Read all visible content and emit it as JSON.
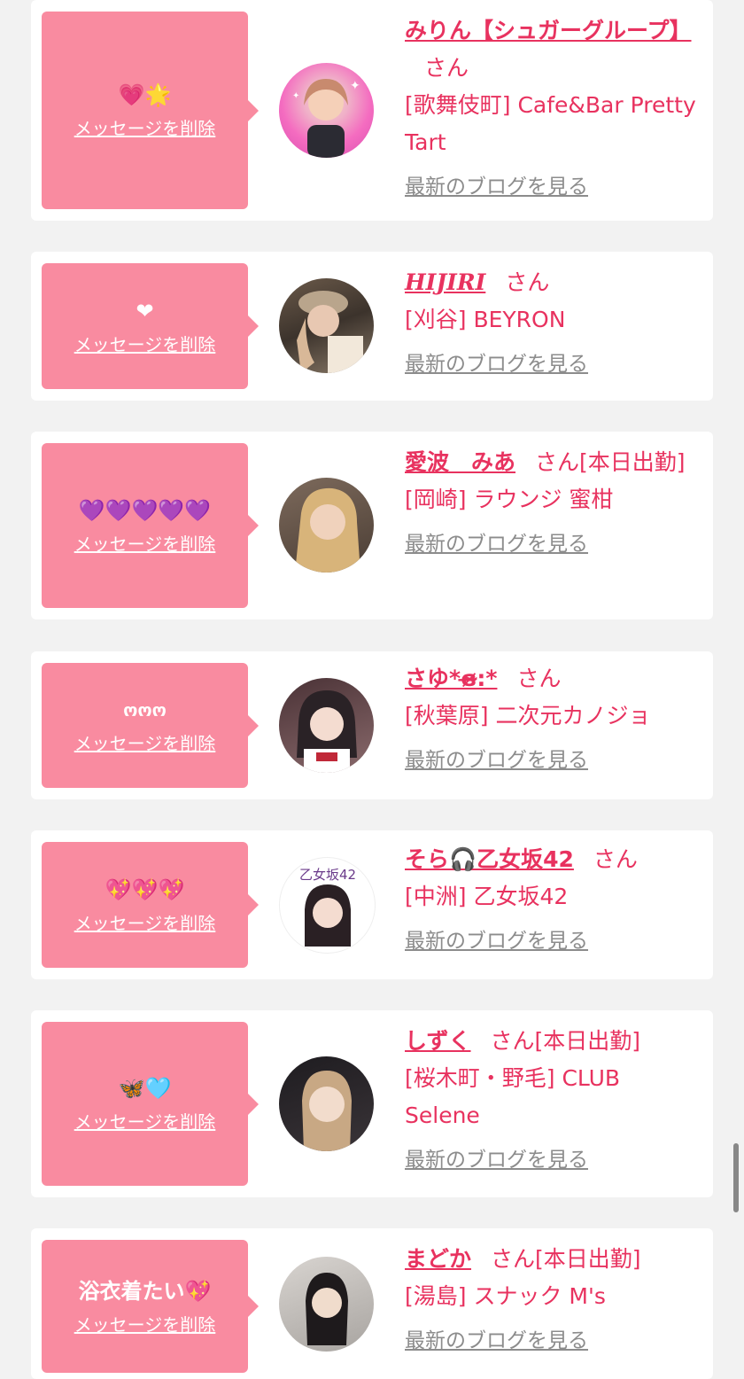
{
  "common": {
    "delete_label": "メッセージを削除",
    "blog_label": "最新のブログを見る",
    "san": "さん"
  },
  "colors": {
    "page_bg": "#f2f2f2",
    "card_bg": "#ffffff",
    "bubble_bg": "#f98ba0",
    "accent": "#e8325f",
    "blog_link": "#8c8c8c"
  },
  "cards": [
    {
      "message": "💗🌟",
      "name": "みりん【シュガーグループ】",
      "suffix": "",
      "shop": "[歌舞伎町] Cafe&Bar Pretty Tart",
      "avatar_desc": "pink-haired-avatar"
    },
    {
      "message": "❤",
      "name": "HIJIRI",
      "suffix": "",
      "shop": "[刈谷] BEYRON",
      "avatar_desc": "avatar-with-cap"
    },
    {
      "message": "💜💜💜💜💜",
      "name": "愛波　みあ",
      "suffix": "[本日出勤]",
      "shop": "[岡崎] ラウンジ 蜜柑",
      "avatar_desc": "avatar-blonde"
    },
    {
      "message": "ოოო",
      "name": "さゆ*ɞ̴̶̷:*",
      "suffix": "",
      "shop": "[秋葉原] 二次元カノジョ",
      "avatar_desc": "avatar-maid"
    },
    {
      "message": "💖💖💖",
      "name": "そら🎧乙女坂42",
      "suffix": "",
      "shop": "[中洲] 乙女坂42",
      "avatar_desc": "avatar-otomezaka",
      "avatar_logo": "乙女坂42"
    },
    {
      "message": "🦋🩵",
      "name": "しずく",
      "suffix": "[本日出勤]",
      "shop": "[桜木町・野毛] CLUB Selene",
      "avatar_desc": "avatar-dark"
    },
    {
      "message": "浴衣着たい💖",
      "name": "まどか",
      "suffix": "[本日出勤]",
      "shop": "[湯島] スナック M's",
      "avatar_desc": "avatar-black-hair"
    }
  ]
}
